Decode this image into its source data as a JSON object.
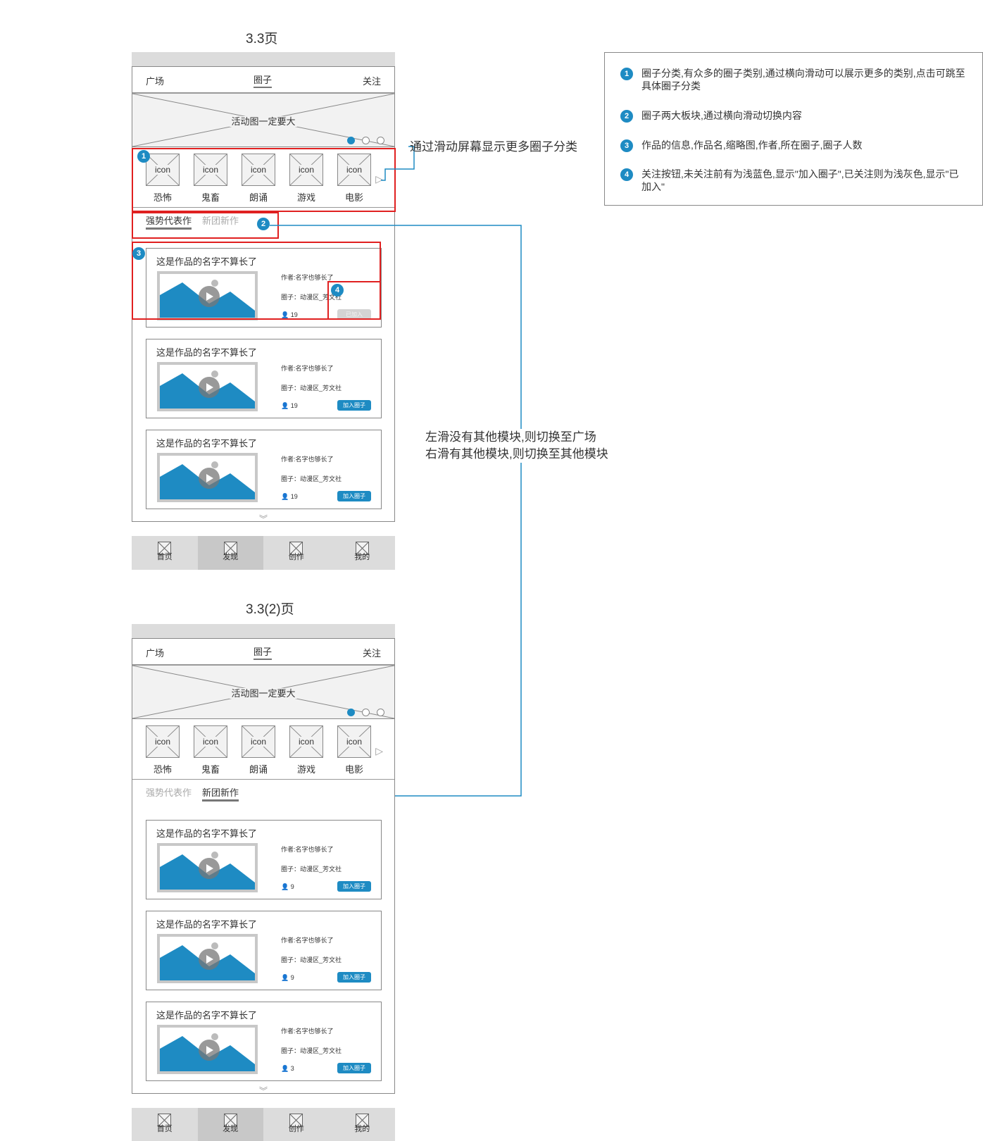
{
  "pages": [
    {
      "title": "3.3页",
      "top_nav": {
        "left": "广场",
        "center": "圈子",
        "right": "关注"
      },
      "banner_text": "活动图一定要大",
      "categories": [
        {
          "icon_text": "icon",
          "label": "恐怖"
        },
        {
          "icon_text": "icon",
          "label": "鬼畜"
        },
        {
          "icon_text": "icon",
          "label": "朗诵"
        },
        {
          "icon_text": "icon",
          "label": "游戏"
        },
        {
          "icon_text": "icon",
          "label": "电影"
        }
      ],
      "tabs": [
        {
          "label": "强势代表作",
          "active": true
        },
        {
          "label": "新团新作",
          "active": false
        }
      ],
      "cards": [
        {
          "title": "这是作品的名字不算长了",
          "author": "作者:名字也够长了",
          "circle": "圈子：动漫区_芳文社",
          "count": "19",
          "button": "已加入",
          "joined": true
        },
        {
          "title": "这是作品的名字不算长了",
          "author": "作者:名字也够长了",
          "circle": "圈子：动漫区_芳文社",
          "count": "19",
          "button": "加入圈子",
          "joined": false
        },
        {
          "title": "这是作品的名字不算长了",
          "author": "作者:名字也够长了",
          "circle": "圈子：动漫区_芳文社",
          "count": "19",
          "button": "加入圈子",
          "joined": false
        }
      ],
      "bottom_tabs": [
        "首页",
        "发现",
        "创作",
        "我的"
      ]
    },
    {
      "title": "3.3(2)页",
      "top_nav": {
        "left": "广场",
        "center": "圈子",
        "right": "关注"
      },
      "banner_text": "活动图一定要大",
      "categories": [
        {
          "icon_text": "icon",
          "label": "恐怖"
        },
        {
          "icon_text": "icon",
          "label": "鬼畜"
        },
        {
          "icon_text": "icon",
          "label": "朗诵"
        },
        {
          "icon_text": "icon",
          "label": "游戏"
        },
        {
          "icon_text": "icon",
          "label": "电影"
        }
      ],
      "tabs": [
        {
          "label": "强势代表作",
          "active": false
        },
        {
          "label": "新团新作",
          "active": true
        }
      ],
      "cards": [
        {
          "title": "这是作品的名字不算长了",
          "author": "作者:名字也够长了",
          "circle": "圈子：动漫区_芳文社",
          "count": "9",
          "button": "加入圈子",
          "joined": false
        },
        {
          "title": "这是作品的名字不算长了",
          "author": "作者:名字也够长了",
          "circle": "圈子：动漫区_芳文社",
          "count": "9",
          "button": "加入圈子",
          "joined": false
        },
        {
          "title": "这是作品的名字不算长了",
          "author": "作者:名字也够长了",
          "circle": "圈子：动漫区_芳文社",
          "count": "3",
          "button": "加入圈子",
          "joined": false
        }
      ],
      "bottom_tabs": [
        "首页",
        "发现",
        "创作",
        "我的"
      ]
    }
  ],
  "badges": [
    "1",
    "2",
    "3",
    "4"
  ],
  "annotations": {
    "swipe_categories": "通过滑动屏幕显示更多圈子分类",
    "swipe_tabs_line1": "左滑没有其他模块,则切换至广场",
    "swipe_tabs_line2": "右滑有其他模块,则切换至其他模块"
  },
  "notes": [
    {
      "num": "1",
      "text": "圈子分类,有众多的圈子类别,通过横向滑动可以展示更多的类别,点击可跳至具体圈子分类"
    },
    {
      "num": "2",
      "text": "圈子两大板块,通过横向滑动切换内容"
    },
    {
      "num": "3",
      "text": "作品的信息,作品名,缩略图,作者,所在圈子,圈子人数"
    },
    {
      "num": "4",
      "text": "关注按钮,未关注前有为浅蓝色,显示\"加入圈子\",已关注则为浅灰色,显示\"已加入\""
    }
  ],
  "colors": {
    "accent": "#1e8bc3",
    "highlight": "#e02020",
    "joined_button": "#d4d4d4"
  }
}
